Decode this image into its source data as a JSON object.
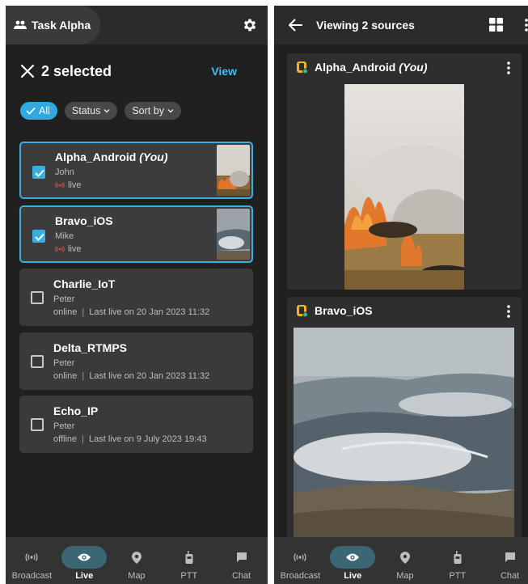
{
  "left": {
    "team_name": "Task Alpha",
    "selection": {
      "count_label": "2 selected",
      "view_label": "View"
    },
    "filters": [
      {
        "label": "All",
        "active": true
      },
      {
        "label": "Status",
        "active": false
      },
      {
        "label": "Sort by",
        "active": false
      }
    ],
    "sources": [
      {
        "name": "Alpha_Android",
        "self_tag": "(You)",
        "user": "John",
        "status": "live",
        "last_live": "",
        "selected": true
      },
      {
        "name": "Bravo_iOS",
        "self_tag": "",
        "user": "Mike",
        "status": "live",
        "last_live": "",
        "selected": true
      },
      {
        "name": "Charlie_IoT",
        "self_tag": "",
        "user": "Peter",
        "status": "online",
        "last_live": "Last live on 20 Jan 2023 11:32",
        "selected": false
      },
      {
        "name": "Delta_RTMPS",
        "self_tag": "",
        "user": "Peter",
        "status": "online",
        "last_live": "Last live on 20 Jan 2023 11:32",
        "selected": false
      },
      {
        "name": "Echo_IP",
        "self_tag": "",
        "user": "Peter",
        "status": "offline",
        "last_live": "Last live on 9 July 2023 19:43",
        "selected": false
      }
    ]
  },
  "right": {
    "title": "Viewing 2 sources",
    "feeds": [
      {
        "name": "Alpha_Android",
        "self_tag": "(You)"
      },
      {
        "name": "Bravo_iOS",
        "self_tag": ""
      }
    ]
  },
  "nav": {
    "items": [
      {
        "label": "Broadcast",
        "icon": "broadcast-icon"
      },
      {
        "label": "Live",
        "icon": "eye-icon",
        "active": true
      },
      {
        "label": "Map",
        "icon": "map-pin-icon"
      },
      {
        "label": "PTT",
        "icon": "walkie-talkie-icon"
      },
      {
        "label": "Chat",
        "icon": "chat-icon"
      }
    ]
  },
  "colors": {
    "accent": "#39aee0",
    "live": "#e0524a",
    "background": "#202020",
    "card": "#3a3a3a",
    "nav_active": "#3b6673"
  }
}
